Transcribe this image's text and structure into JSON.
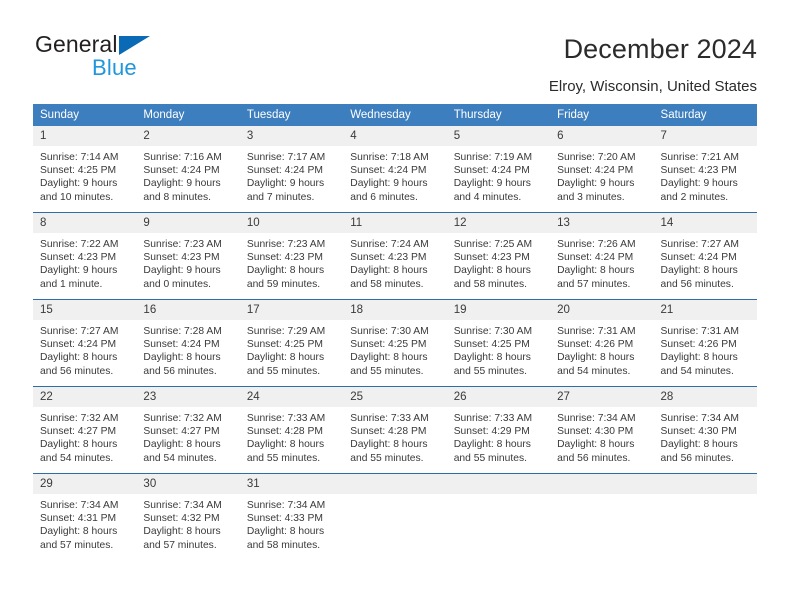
{
  "logo": {
    "word1": "General",
    "word2": "Blue",
    "triangle_color": "#0a6ab5",
    "word2_color": "#2196dd"
  },
  "header": {
    "title": "December 2024",
    "subtitle": "Elroy, Wisconsin, United States",
    "header_bg": "#3d7ebe",
    "daynum_bg": "#f0f0f0",
    "separator_color": "#2e6da8"
  },
  "weekday_headers": [
    "Sunday",
    "Monday",
    "Tuesday",
    "Wednesday",
    "Thursday",
    "Friday",
    "Saturday"
  ],
  "weeks": [
    [
      {
        "day": "1",
        "sunrise": "Sunrise: 7:14 AM",
        "sunset": "Sunset: 4:25 PM",
        "daylight_1": "Daylight: 9 hours",
        "daylight_2": "and 10 minutes."
      },
      {
        "day": "2",
        "sunrise": "Sunrise: 7:16 AM",
        "sunset": "Sunset: 4:24 PM",
        "daylight_1": "Daylight: 9 hours",
        "daylight_2": "and 8 minutes."
      },
      {
        "day": "3",
        "sunrise": "Sunrise: 7:17 AM",
        "sunset": "Sunset: 4:24 PM",
        "daylight_1": "Daylight: 9 hours",
        "daylight_2": "and 7 minutes."
      },
      {
        "day": "4",
        "sunrise": "Sunrise: 7:18 AM",
        "sunset": "Sunset: 4:24 PM",
        "daylight_1": "Daylight: 9 hours",
        "daylight_2": "and 6 minutes."
      },
      {
        "day": "5",
        "sunrise": "Sunrise: 7:19 AM",
        "sunset": "Sunset: 4:24 PM",
        "daylight_1": "Daylight: 9 hours",
        "daylight_2": "and 4 minutes."
      },
      {
        "day": "6",
        "sunrise": "Sunrise: 7:20 AM",
        "sunset": "Sunset: 4:24 PM",
        "daylight_1": "Daylight: 9 hours",
        "daylight_2": "and 3 minutes."
      },
      {
        "day": "7",
        "sunrise": "Sunrise: 7:21 AM",
        "sunset": "Sunset: 4:23 PM",
        "daylight_1": "Daylight: 9 hours",
        "daylight_2": "and 2 minutes."
      }
    ],
    [
      {
        "day": "8",
        "sunrise": "Sunrise: 7:22 AM",
        "sunset": "Sunset: 4:23 PM",
        "daylight_1": "Daylight: 9 hours",
        "daylight_2": "and 1 minute."
      },
      {
        "day": "9",
        "sunrise": "Sunrise: 7:23 AM",
        "sunset": "Sunset: 4:23 PM",
        "daylight_1": "Daylight: 9 hours",
        "daylight_2": "and 0 minutes."
      },
      {
        "day": "10",
        "sunrise": "Sunrise: 7:23 AM",
        "sunset": "Sunset: 4:23 PM",
        "daylight_1": "Daylight: 8 hours",
        "daylight_2": "and 59 minutes."
      },
      {
        "day": "11",
        "sunrise": "Sunrise: 7:24 AM",
        "sunset": "Sunset: 4:23 PM",
        "daylight_1": "Daylight: 8 hours",
        "daylight_2": "and 58 minutes."
      },
      {
        "day": "12",
        "sunrise": "Sunrise: 7:25 AM",
        "sunset": "Sunset: 4:23 PM",
        "daylight_1": "Daylight: 8 hours",
        "daylight_2": "and 58 minutes."
      },
      {
        "day": "13",
        "sunrise": "Sunrise: 7:26 AM",
        "sunset": "Sunset: 4:24 PM",
        "daylight_1": "Daylight: 8 hours",
        "daylight_2": "and 57 minutes."
      },
      {
        "day": "14",
        "sunrise": "Sunrise: 7:27 AM",
        "sunset": "Sunset: 4:24 PM",
        "daylight_1": "Daylight: 8 hours",
        "daylight_2": "and 56 minutes."
      }
    ],
    [
      {
        "day": "15",
        "sunrise": "Sunrise: 7:27 AM",
        "sunset": "Sunset: 4:24 PM",
        "daylight_1": "Daylight: 8 hours",
        "daylight_2": "and 56 minutes."
      },
      {
        "day": "16",
        "sunrise": "Sunrise: 7:28 AM",
        "sunset": "Sunset: 4:24 PM",
        "daylight_1": "Daylight: 8 hours",
        "daylight_2": "and 56 minutes."
      },
      {
        "day": "17",
        "sunrise": "Sunrise: 7:29 AM",
        "sunset": "Sunset: 4:25 PM",
        "daylight_1": "Daylight: 8 hours",
        "daylight_2": "and 55 minutes."
      },
      {
        "day": "18",
        "sunrise": "Sunrise: 7:30 AM",
        "sunset": "Sunset: 4:25 PM",
        "daylight_1": "Daylight: 8 hours",
        "daylight_2": "and 55 minutes."
      },
      {
        "day": "19",
        "sunrise": "Sunrise: 7:30 AM",
        "sunset": "Sunset: 4:25 PM",
        "daylight_1": "Daylight: 8 hours",
        "daylight_2": "and 55 minutes."
      },
      {
        "day": "20",
        "sunrise": "Sunrise: 7:31 AM",
        "sunset": "Sunset: 4:26 PM",
        "daylight_1": "Daylight: 8 hours",
        "daylight_2": "and 54 minutes."
      },
      {
        "day": "21",
        "sunrise": "Sunrise: 7:31 AM",
        "sunset": "Sunset: 4:26 PM",
        "daylight_1": "Daylight: 8 hours",
        "daylight_2": "and 54 minutes."
      }
    ],
    [
      {
        "day": "22",
        "sunrise": "Sunrise: 7:32 AM",
        "sunset": "Sunset: 4:27 PM",
        "daylight_1": "Daylight: 8 hours",
        "daylight_2": "and 54 minutes."
      },
      {
        "day": "23",
        "sunrise": "Sunrise: 7:32 AM",
        "sunset": "Sunset: 4:27 PM",
        "daylight_1": "Daylight: 8 hours",
        "daylight_2": "and 54 minutes."
      },
      {
        "day": "24",
        "sunrise": "Sunrise: 7:33 AM",
        "sunset": "Sunset: 4:28 PM",
        "daylight_1": "Daylight: 8 hours",
        "daylight_2": "and 55 minutes."
      },
      {
        "day": "25",
        "sunrise": "Sunrise: 7:33 AM",
        "sunset": "Sunset: 4:28 PM",
        "daylight_1": "Daylight: 8 hours",
        "daylight_2": "and 55 minutes."
      },
      {
        "day": "26",
        "sunrise": "Sunrise: 7:33 AM",
        "sunset": "Sunset: 4:29 PM",
        "daylight_1": "Daylight: 8 hours",
        "daylight_2": "and 55 minutes."
      },
      {
        "day": "27",
        "sunrise": "Sunrise: 7:34 AM",
        "sunset": "Sunset: 4:30 PM",
        "daylight_1": "Daylight: 8 hours",
        "daylight_2": "and 56 minutes."
      },
      {
        "day": "28",
        "sunrise": "Sunrise: 7:34 AM",
        "sunset": "Sunset: 4:30 PM",
        "daylight_1": "Daylight: 8 hours",
        "daylight_2": "and 56 minutes."
      }
    ],
    [
      {
        "day": "29",
        "sunrise": "Sunrise: 7:34 AM",
        "sunset": "Sunset: 4:31 PM",
        "daylight_1": "Daylight: 8 hours",
        "daylight_2": "and 57 minutes."
      },
      {
        "day": "30",
        "sunrise": "Sunrise: 7:34 AM",
        "sunset": "Sunset: 4:32 PM",
        "daylight_1": "Daylight: 8 hours",
        "daylight_2": "and 57 minutes."
      },
      {
        "day": "31",
        "sunrise": "Sunrise: 7:34 AM",
        "sunset": "Sunset: 4:33 PM",
        "daylight_1": "Daylight: 8 hours",
        "daylight_2": "and 58 minutes."
      },
      {
        "day": "",
        "sunrise": "",
        "sunset": "",
        "daylight_1": "",
        "daylight_2": ""
      },
      {
        "day": "",
        "sunrise": "",
        "sunset": "",
        "daylight_1": "",
        "daylight_2": ""
      },
      {
        "day": "",
        "sunrise": "",
        "sunset": "",
        "daylight_1": "",
        "daylight_2": ""
      },
      {
        "day": "",
        "sunrise": "",
        "sunset": "",
        "daylight_1": "",
        "daylight_2": ""
      }
    ]
  ]
}
